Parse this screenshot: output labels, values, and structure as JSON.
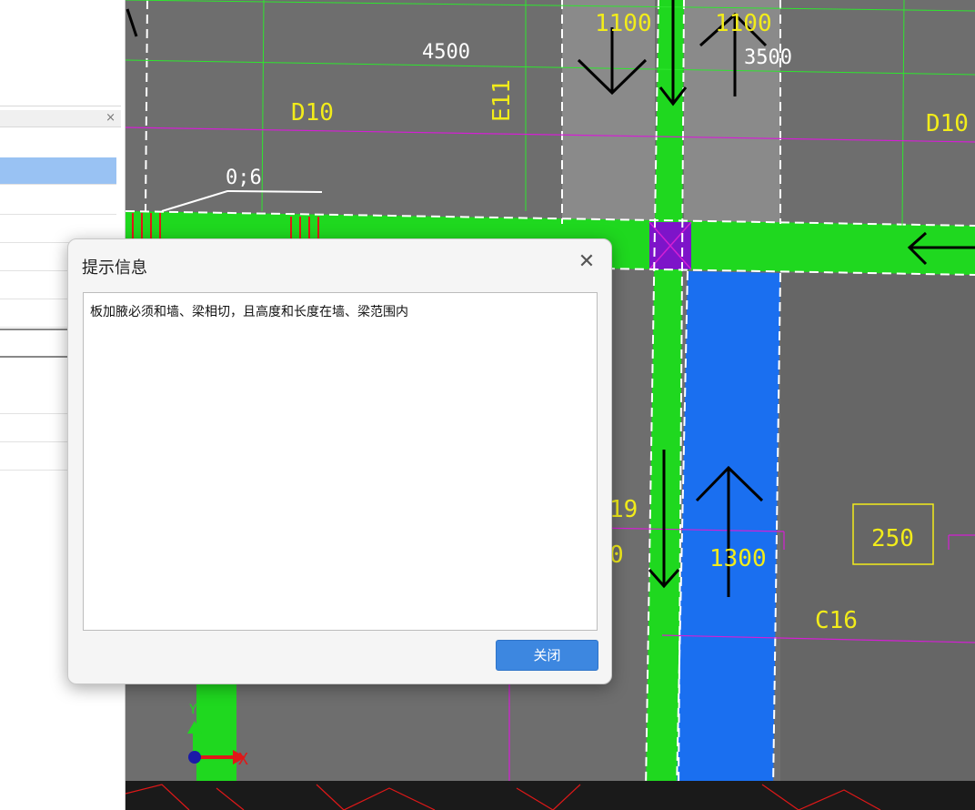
{
  "left_panel": {
    "close_glyph": "×"
  },
  "cad": {
    "labels": {
      "dim_1100_a": "1100",
      "dim_1100_b": "1100",
      "dim_4500": "4500",
      "dim_3500": "3500",
      "label_d10_left": "D10",
      "label_e11": "E11",
      "label_d10_right": "D10",
      "label_0_6": "0;6",
      "label_19": "19",
      "label_0": "0",
      "dim_1300": "1300",
      "box_250": "250",
      "label_c16": "C16",
      "axis_x": "X",
      "axis_y": "Y"
    },
    "colors": {
      "background": "#6e6e6e",
      "beam": "#1fd81f",
      "slab_selected": "#1a6ff0",
      "column": "#7d14c9",
      "text": "#f2ec1a",
      "grid_green": "#2ee62e",
      "grid_magenta": "#d41fd4"
    }
  },
  "dialog": {
    "title": "提示信息",
    "close_glyph": "✕",
    "message": "板加腋必须和墙、梁相切，且高度和长度在墙、梁范围内",
    "ok_label": "关闭"
  }
}
